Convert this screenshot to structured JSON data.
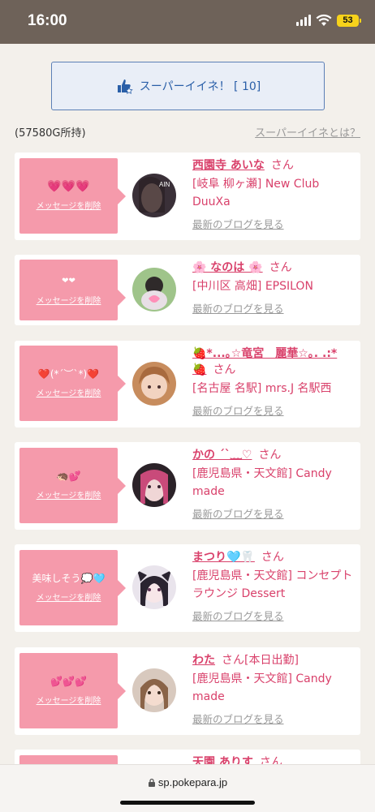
{
  "status": {
    "time": "16:00",
    "battery": "53"
  },
  "super_like": {
    "label": "スーパーイイネ！ [ 10]"
  },
  "owned": "(57580G所持)",
  "about_link": "スーパーイイネとは？",
  "delete_label": "メッセージを削除",
  "san": "さん",
  "blog_link": "最新のブログを見る",
  "cards": [
    {
      "message": "💗💗💗",
      "name": "西園寺 あいな",
      "shop": "[岐阜 柳ヶ瀬] New Club DuuXa"
    },
    {
      "message": "❤❤",
      "name": "🌸 なのは 🌸",
      "shop": "[中川区 高畑] EPSILON"
    },
    {
      "message": "❤️(*´︶`*)❤️",
      "name": "🍓*...｡☆竜宮　麗華☆｡. .:* 🍓",
      "shop": "[名古屋 名駅] mrs.J 名駅西"
    },
    {
      "message": "🦔💕",
      "name": "かの ˊˋ﹏♡",
      "shop": "[鹿児島県・天文館] Candy made"
    },
    {
      "message": "美味しそう💭🩵",
      "name": "まつり🩵🦷",
      "shop": "[鹿児島県・天文館] コンセプトラウンジ Dessert"
    },
    {
      "message": "💕💕💕",
      "name": "わた",
      "name_suffix": "さん[本日出勤]",
      "shop": "[鹿児島県・天文館] Candy made"
    },
    {
      "name": "天園 ありす"
    }
  ],
  "browser": {
    "url": "sp.pokepara.jp"
  }
}
